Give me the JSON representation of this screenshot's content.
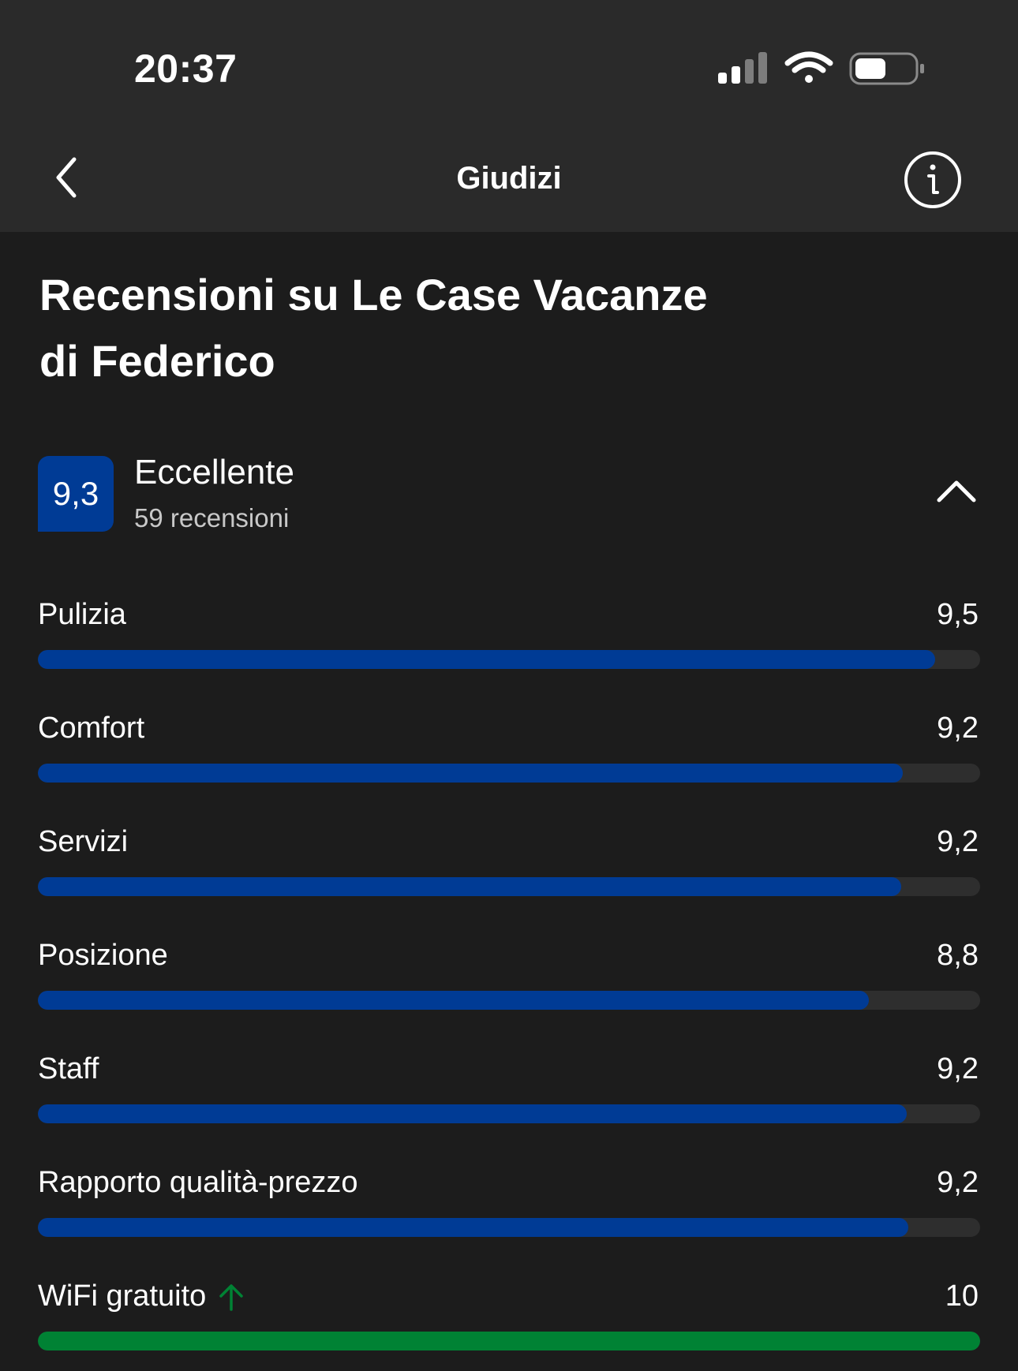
{
  "status_bar": {
    "time": "20:37"
  },
  "nav": {
    "title": "Giudizi"
  },
  "page": {
    "heading_line1": "Recensioni su Le Case Vacanze",
    "heading_line2": "di Federico"
  },
  "summary": {
    "score": "9,3",
    "rating_word": "Eccellente",
    "review_count": "59 recensioni"
  },
  "categories": [
    {
      "label": "Pulizia",
      "score": "9,5",
      "fill": 0.952,
      "color": "#003b95"
    },
    {
      "label": "Comfort",
      "score": "9,2",
      "fill": 0.918,
      "color": "#003b95"
    },
    {
      "label": "Servizi",
      "score": "9,2",
      "fill": 0.916,
      "color": "#003b95"
    },
    {
      "label": "Posizione",
      "score": "8,8",
      "fill": 0.882,
      "color": "#003b95"
    },
    {
      "label": "Staff",
      "score": "9,2",
      "fill": 0.922,
      "color": "#003b95"
    },
    {
      "label": "Rapporto qualità-prezzo",
      "score": "9,2",
      "fill": 0.924,
      "color": "#003b95"
    },
    {
      "label": "WiFi gratuito",
      "score": "10",
      "fill": 1.0,
      "color": "#008234",
      "trend_icon": "arrow-up-icon"
    }
  ],
  "colors": {
    "brand_blue": "#003b95",
    "positive_green": "#008234",
    "track": "#2e2e2e"
  }
}
